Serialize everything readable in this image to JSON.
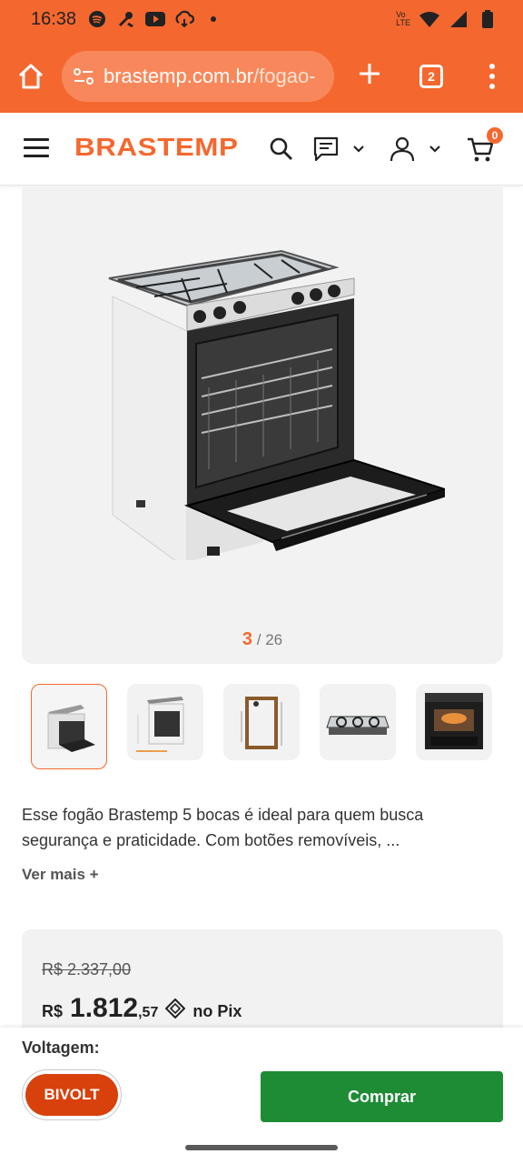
{
  "status_bar": {
    "time": "16:38",
    "network_label": "LTE",
    "icons": [
      "spotify-icon",
      "tools-icon",
      "youtube-icon",
      "cloud-icon",
      "dot-icon",
      "wifi-icon",
      "signal-icon",
      "battery-icon"
    ]
  },
  "browser": {
    "url_domain": "brastemp.com.br",
    "url_path": "/fogao-",
    "tab_count": "2",
    "colors": {
      "toolbar": "#f4682f",
      "urlbar": "#f8885b"
    }
  },
  "site_header": {
    "logo": "BRASTEMP",
    "cart_count": "0"
  },
  "product": {
    "image_counter_current": "3",
    "image_counter_total": "/ 26",
    "thumbnail_count": 5,
    "description": "Esse fogão Brastemp 5 bocas é ideal para quem busca segurança e praticidade. Com botões removíveis, ...",
    "see_more": "Ver mais +"
  },
  "price": {
    "old_price": "R$ 2.337,00",
    "currency": "R$",
    "price_main": "1.812",
    "price_cents": ",57",
    "payment_method": "no Pix"
  },
  "purchase_bar": {
    "voltage_label": "Voltagem:",
    "voltage_option": "BIVOLT",
    "buy_label": "Comprar",
    "colors": {
      "voltage": "#d8410b",
      "buy": "#1e8c35"
    }
  }
}
